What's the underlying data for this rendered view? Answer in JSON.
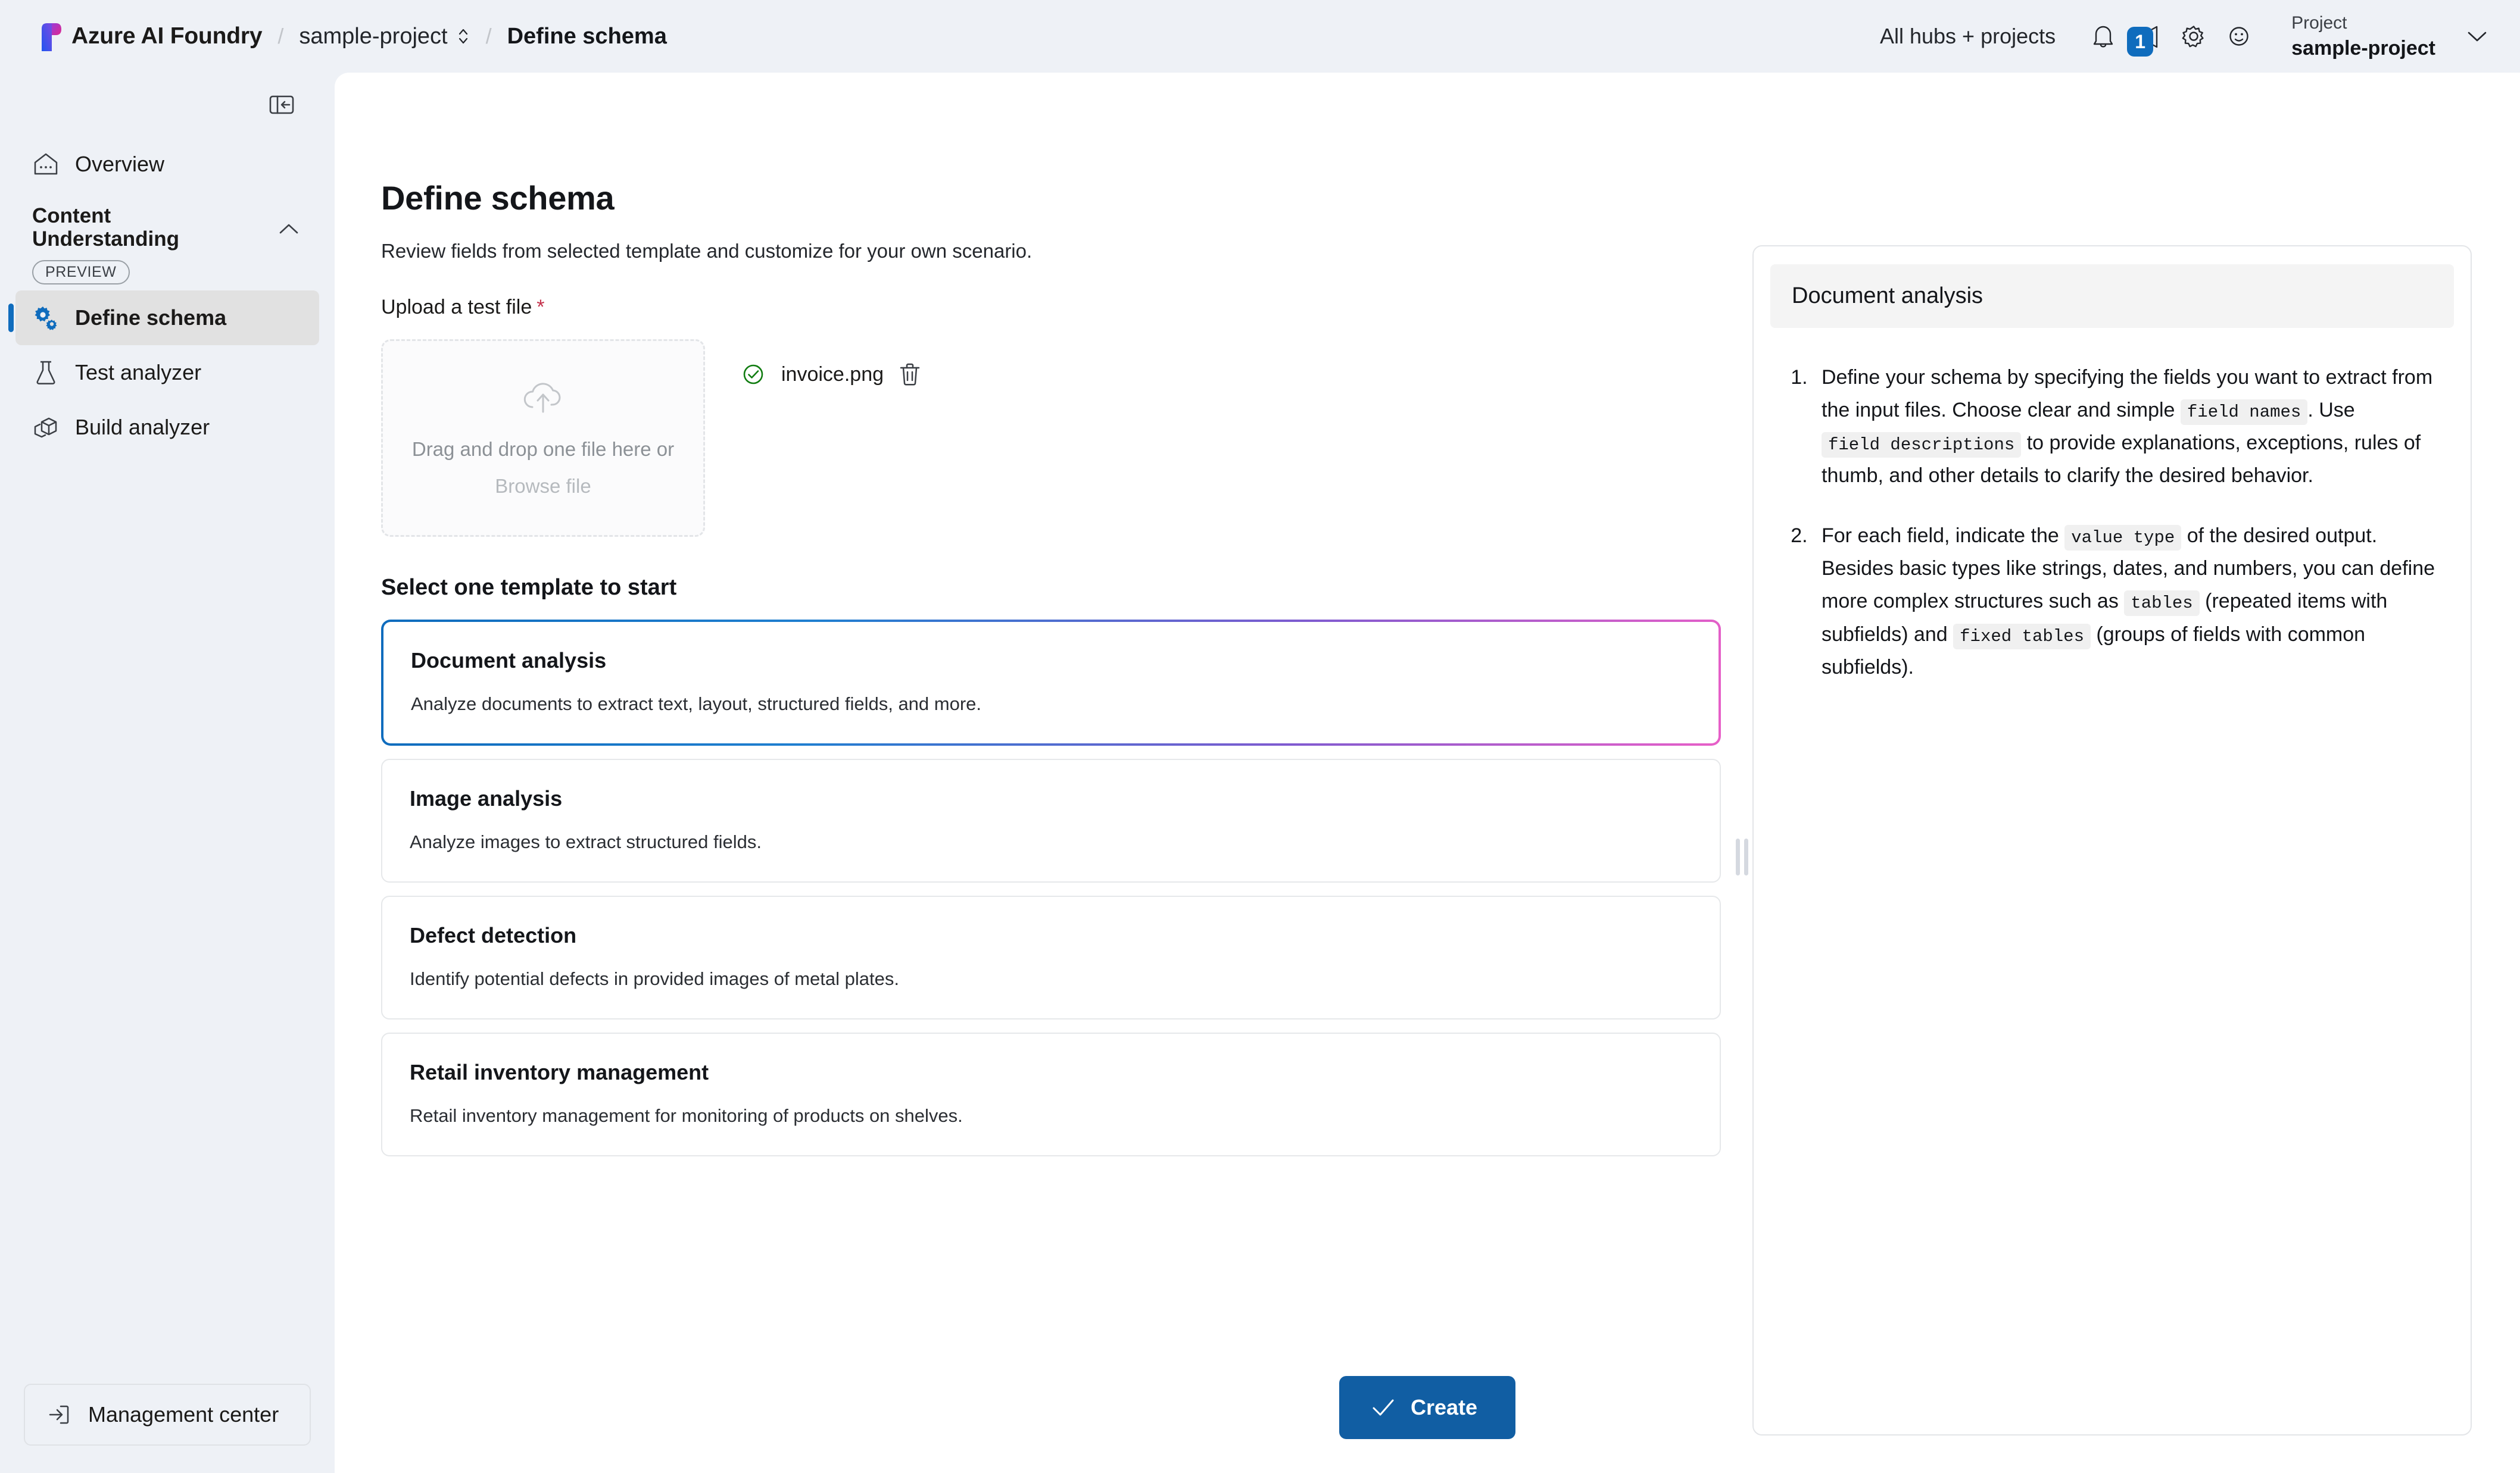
{
  "topbar": {
    "brand": "Azure AI Foundry",
    "breadcrumb_separator": "/",
    "project_crumb": "sample-project",
    "current_crumb": "Define schema",
    "hubs_link": "All hubs + projects",
    "notifications_icon": "bell-icon",
    "announcements_icon": "megaphone-icon",
    "announcements_badge": "1",
    "settings_icon": "gear-icon",
    "feedback_icon": "smiley-icon",
    "project_switcher": {
      "label": "Project",
      "value": "sample-project",
      "chevron_icon": "chevron-down-icon"
    }
  },
  "sidebar": {
    "collapse_icon": "panel-collapse-icon",
    "overview": {
      "label": "Overview",
      "icon": "home-icon"
    },
    "group": {
      "title": "Content Understanding",
      "badge": "PREVIEW",
      "chevron_icon": "chevron-up-icon"
    },
    "items": [
      {
        "label": "Define schema",
        "icon": "gears-icon",
        "active": true
      },
      {
        "label": "Test analyzer",
        "icon": "flask-icon",
        "active": false
      },
      {
        "label": "Build analyzer",
        "icon": "cube-icon",
        "active": false
      }
    ],
    "management_center": {
      "label": "Management center",
      "icon": "arrow-into-box-icon"
    }
  },
  "main": {
    "title": "Define schema",
    "subtitle": "Review fields from selected template and customize for your own scenario.",
    "upload_label": "Upload a test file",
    "required_marker": "*",
    "dropzone": {
      "icon": "cloud-upload-icon",
      "line1": "Drag and drop one file here or",
      "line2": "Browse file"
    },
    "uploaded_file": {
      "status_icon": "check-circle-icon",
      "name": "invoice.png",
      "delete_icon": "trash-icon"
    },
    "templates_title": "Select one template to start",
    "templates": [
      {
        "name": "Document analysis",
        "description": "Analyze documents to extract text, layout, structured fields, and more.",
        "selected": true
      },
      {
        "name": "Image analysis",
        "description": "Analyze images to extract structured fields.",
        "selected": false
      },
      {
        "name": "Defect detection",
        "description": "Identify potential defects in provided images of metal plates.",
        "selected": false
      },
      {
        "name": "Retail inventory management",
        "description": "Retail inventory management for monitoring of products on shelves.",
        "selected": false
      }
    ],
    "create_button": {
      "label": "Create",
      "icon": "checkmark-icon"
    }
  },
  "right_panel": {
    "header": "Document analysis",
    "steps": [
      {
        "parts": [
          {
            "type": "text",
            "value": "Define your schema by specifying the fields you want to extract from the input files. Choose clear and simple "
          },
          {
            "type": "code",
            "value": "field names"
          },
          {
            "type": "text",
            "value": ". Use "
          },
          {
            "type": "code",
            "value": "field descriptions"
          },
          {
            "type": "text",
            "value": " to provide explanations, exceptions, rules of thumb, and other details to clarify the desired behavior."
          }
        ]
      },
      {
        "parts": [
          {
            "type": "text",
            "value": "For each field, indicate the "
          },
          {
            "type": "code",
            "value": "value type"
          },
          {
            "type": "text",
            "value": " of the desired output. Besides basic types like strings, dates, and numbers, you can define more complex structures such as "
          },
          {
            "type": "code",
            "value": "tables"
          },
          {
            "type": "text",
            "value": " (repeated items with subfields) and "
          },
          {
            "type": "code",
            "value": "fixed tables"
          },
          {
            "type": "text",
            "value": " (groups of fields with common subfields)."
          }
        ]
      }
    ]
  },
  "colors": {
    "accent_blue": "#0f6cbd",
    "primary_button": "#115ea3",
    "page_background": "#eef1f6",
    "panel_background": "#ffffff",
    "required_red": "#c4314b",
    "success_green": "#107c10",
    "selected_border_start": "#0f6cbd",
    "selected_border_end": "#e85fc8"
  }
}
